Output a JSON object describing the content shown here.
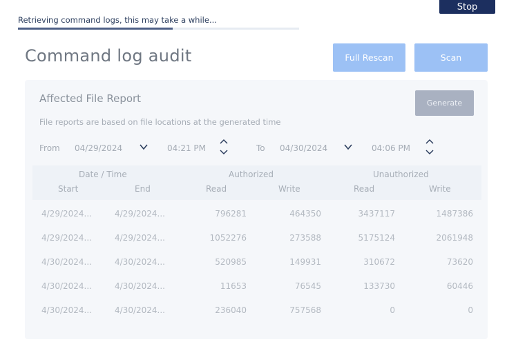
{
  "toolbar": {
    "stop_label": "Stop"
  },
  "status": {
    "message": "Retrieving command logs, this may take a while...",
    "progress": 0.55
  },
  "page": {
    "title": "Command log audit"
  },
  "actions": {
    "full_rescan_label": "Full Rescan",
    "scan_label": "Scan"
  },
  "report": {
    "title": "Affected File Report",
    "generate_label": "Generate",
    "subtitle": "File reports are based on file locations at the generated time",
    "from_label": "From",
    "from_date": "04/29/2024",
    "from_time": "04:21 PM",
    "to_label": "To",
    "to_date": "04/30/2024",
    "to_time": "04:06 PM"
  },
  "table": {
    "group_headers": {
      "datetime": "Date / Time",
      "authorized": "Authorized",
      "unauthorized": "Unauthorized"
    },
    "columns": {
      "start": "Start",
      "end": "End",
      "auth_read": "Read",
      "auth_write": "Write",
      "unauth_read": "Read",
      "unauth_write": "Write"
    },
    "rows": [
      {
        "start": "4/29/2024...",
        "end": "4/29/2024...",
        "auth_read": "796281",
        "auth_write": "464350",
        "unauth_read": "3437117",
        "unauth_write": "1487386"
      },
      {
        "start": "4/29/2024...",
        "end": "4/29/2024...",
        "auth_read": "1052276",
        "auth_write": "273588",
        "unauth_read": "5175124",
        "unauth_write": "2061948"
      },
      {
        "start": "4/30/2024...",
        "end": "4/30/2024...",
        "auth_read": "520985",
        "auth_write": "149931",
        "unauth_read": "310672",
        "unauth_write": "73620"
      },
      {
        "start": "4/30/2024...",
        "end": "4/30/2024...",
        "auth_read": "11653",
        "auth_write": "76545",
        "unauth_read": "133730",
        "unauth_write": "60446"
      },
      {
        "start": "4/30/2024...",
        "end": "4/30/2024...",
        "auth_read": "236040",
        "auth_write": "757568",
        "unauth_read": "0",
        "unauth_write": "0"
      }
    ]
  },
  "icons": {
    "date_picker": "chevron-down-icon",
    "time_spinner": "up-down-chevron-icon"
  }
}
